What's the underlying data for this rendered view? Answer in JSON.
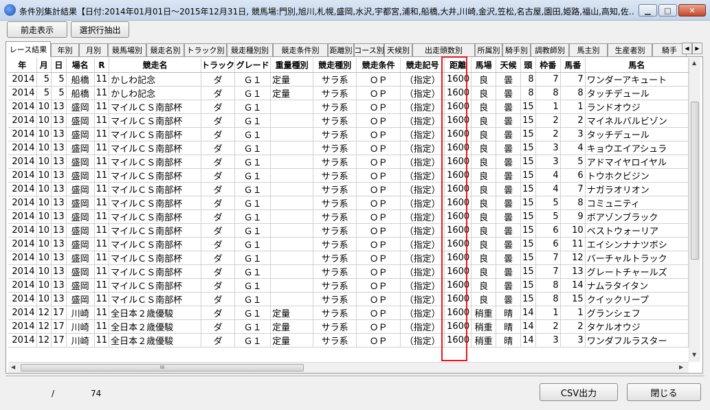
{
  "window": {
    "title": "条件別集計結果【日付:2014年01月01日～2015年12月31日, 競馬場:門別,旭川,札幌,盛岡,水沢,宇都宮,浦和,船橋,大井,川崎,金沢,笠松,名古屋,園田,姫路,福山,高知,佐…",
    "minimize_label": "▁",
    "maximize_label": "□",
    "close_label": "✕"
  },
  "toolbar": {
    "prev_label": "前走表示",
    "extract_label": "選択行抽出"
  },
  "tabs": [
    "レース結果",
    "年別",
    "月別",
    "競馬場別",
    "競走名別",
    "トラック別",
    "競走種別別",
    "競走条件別",
    "距離別",
    "コース別",
    "天候別",
    "出走頭数別",
    "所属別",
    "騎手別",
    "調教師別",
    "馬主別",
    "生産者別",
    "騎手"
  ],
  "tab_scroll": {
    "left": "◀",
    "right": "▶"
  },
  "grid": {
    "columns": [
      "年",
      "月",
      "日",
      "場名",
      "R",
      "競走名",
      "トラック",
      "グレード",
      "重量種別",
      "競走種別",
      "競走条件",
      "競走記号",
      "距離",
      "馬場",
      "天候",
      "頭",
      "枠番",
      "馬番",
      "馬名"
    ],
    "rows": [
      [
        "2014",
        "5",
        "5",
        "船橋",
        "11",
        "かしわ記念",
        "ダ",
        "Ｇ１",
        "定量",
        "サラ系",
        "ＯＰ",
        "（指定）",
        "1600",
        "良",
        "曇",
        "8",
        "7",
        "7",
        "ワンダーアキュート"
      ],
      [
        "2014",
        "5",
        "5",
        "船橋",
        "11",
        "かしわ記念",
        "ダ",
        "Ｇ１",
        "定量",
        "サラ系",
        "ＯＰ",
        "（指定）",
        "1600",
        "良",
        "曇",
        "8",
        "8",
        "8",
        "タッチデュール"
      ],
      [
        "2014",
        "10",
        "13",
        "盛岡",
        "11",
        "マイルＣＳ南部杯",
        "ダ",
        "Ｇ１",
        "",
        "サラ系",
        "ＯＰ",
        "（指定）",
        "1600",
        "良",
        "曇",
        "15",
        "1",
        "1",
        "ランドオウジ"
      ],
      [
        "2014",
        "10",
        "13",
        "盛岡",
        "11",
        "マイルＣＳ南部杯",
        "ダ",
        "Ｇ１",
        "",
        "サラ系",
        "ＯＰ",
        "（指定）",
        "1600",
        "良",
        "曇",
        "15",
        "2",
        "2",
        "マイネルバルビゾン"
      ],
      [
        "2014",
        "10",
        "13",
        "盛岡",
        "11",
        "マイルＣＳ南部杯",
        "ダ",
        "Ｇ１",
        "",
        "サラ系",
        "ＯＰ",
        "（指定）",
        "1600",
        "良",
        "曇",
        "15",
        "2",
        "3",
        "タッチデュール"
      ],
      [
        "2014",
        "10",
        "13",
        "盛岡",
        "11",
        "マイルＣＳ南部杯",
        "ダ",
        "Ｇ１",
        "",
        "サラ系",
        "ＯＰ",
        "（指定）",
        "1600",
        "良",
        "曇",
        "15",
        "3",
        "4",
        "キョウエイアシュラ"
      ],
      [
        "2014",
        "10",
        "13",
        "盛岡",
        "11",
        "マイルＣＳ南部杯",
        "ダ",
        "Ｇ１",
        "",
        "サラ系",
        "ＯＰ",
        "（指定）",
        "1600",
        "良",
        "曇",
        "15",
        "3",
        "5",
        "アドマイヤロイヤル"
      ],
      [
        "2014",
        "10",
        "13",
        "盛岡",
        "11",
        "マイルＣＳ南部杯",
        "ダ",
        "Ｇ１",
        "",
        "サラ系",
        "ＯＰ",
        "（指定）",
        "1600",
        "良",
        "曇",
        "15",
        "4",
        "6",
        "トウホクビジン"
      ],
      [
        "2014",
        "10",
        "13",
        "盛岡",
        "11",
        "マイルＣＳ南部杯",
        "ダ",
        "Ｇ１",
        "",
        "サラ系",
        "ＯＰ",
        "（指定）",
        "1600",
        "良",
        "曇",
        "15",
        "4",
        "7",
        "ナガラオリオン"
      ],
      [
        "2014",
        "10",
        "13",
        "盛岡",
        "11",
        "マイルＣＳ南部杯",
        "ダ",
        "Ｇ１",
        "",
        "サラ系",
        "ＯＰ",
        "（指定）",
        "1600",
        "良",
        "曇",
        "15",
        "5",
        "8",
        "コミュニティ"
      ],
      [
        "2014",
        "10",
        "13",
        "盛岡",
        "11",
        "マイルＣＳ南部杯",
        "ダ",
        "Ｇ１",
        "",
        "サラ系",
        "ＯＰ",
        "（指定）",
        "1600",
        "良",
        "曇",
        "15",
        "5",
        "9",
        "ボアゾンブラック"
      ],
      [
        "2014",
        "10",
        "13",
        "盛岡",
        "11",
        "マイルＣＳ南部杯",
        "ダ",
        "Ｇ１",
        "",
        "サラ系",
        "ＯＰ",
        "（指定）",
        "1600",
        "良",
        "曇",
        "15",
        "6",
        "10",
        "ベストウォーリア"
      ],
      [
        "2014",
        "10",
        "13",
        "盛岡",
        "11",
        "マイルＣＳ南部杯",
        "ダ",
        "Ｇ１",
        "",
        "サラ系",
        "ＯＰ",
        "（指定）",
        "1600",
        "良",
        "曇",
        "15",
        "6",
        "11",
        "エイシンナナツボシ"
      ],
      [
        "2014",
        "10",
        "13",
        "盛岡",
        "11",
        "マイルＣＳ南部杯",
        "ダ",
        "Ｇ１",
        "",
        "サラ系",
        "ＯＰ",
        "（指定）",
        "1600",
        "良",
        "曇",
        "15",
        "7",
        "12",
        "バーチャルトラック"
      ],
      [
        "2014",
        "10",
        "13",
        "盛岡",
        "11",
        "マイルＣＳ南部杯",
        "ダ",
        "Ｇ１",
        "",
        "サラ系",
        "ＯＰ",
        "（指定）",
        "1600",
        "良",
        "曇",
        "15",
        "7",
        "13",
        "グレートチャールズ"
      ],
      [
        "2014",
        "10",
        "13",
        "盛岡",
        "11",
        "マイルＣＳ南部杯",
        "ダ",
        "Ｇ１",
        "",
        "サラ系",
        "ＯＰ",
        "（指定）",
        "1600",
        "良",
        "曇",
        "15",
        "8",
        "14",
        "ナムラタイタン"
      ],
      [
        "2014",
        "10",
        "13",
        "盛岡",
        "11",
        "マイルＣＳ南部杯",
        "ダ",
        "Ｇ１",
        "",
        "サラ系",
        "ＯＰ",
        "（指定）",
        "1600",
        "良",
        "曇",
        "15",
        "8",
        "15",
        "クイックリープ"
      ],
      [
        "2014",
        "12",
        "17",
        "川崎",
        "11",
        "全日本２歳優駿",
        "ダ",
        "Ｇ１",
        "定量",
        "サラ系",
        "ＯＰ",
        "（指定）",
        "1600",
        "稍重",
        "晴",
        "14",
        "1",
        "1",
        "グランシェフ"
      ],
      [
        "2014",
        "12",
        "17",
        "川崎",
        "11",
        "全日本２歳優駿",
        "ダ",
        "Ｇ１",
        "定量",
        "サラ系",
        "ＯＰ",
        "（指定）",
        "1600",
        "稍重",
        "晴",
        "14",
        "2",
        "2",
        "タケルオウジ"
      ],
      [
        "2014",
        "12",
        "17",
        "川崎",
        "11",
        "全日本２歳優駿",
        "ダ",
        "Ｇ１",
        "定量",
        "サラ系",
        "ＯＰ",
        "（指定）",
        "1600",
        "稍重",
        "晴",
        "14",
        "3",
        "3",
        "ワンダフルラスター"
      ]
    ]
  },
  "scroll": {
    "hthumb_grip": "III",
    "up": "▲",
    "down": "▼",
    "left": "◀",
    "right": "▶"
  },
  "status": {
    "selected": "/",
    "total": "74"
  },
  "footer": {
    "csv_label": "CSV出力",
    "close_label": "閉じる"
  },
  "colors": {
    "highlight": "#e8161b"
  }
}
